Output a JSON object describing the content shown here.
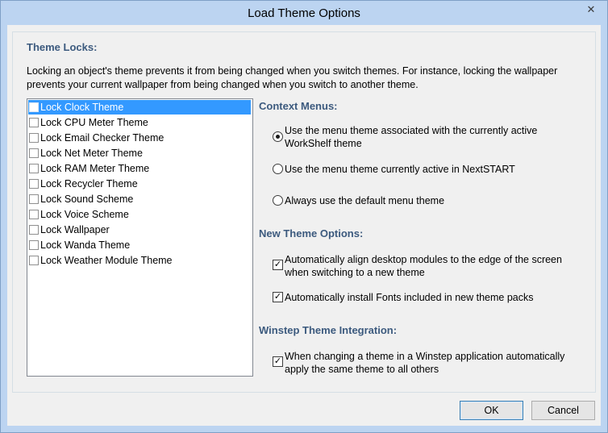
{
  "window": {
    "title": "Load Theme Options"
  },
  "theme_locks": {
    "heading": "Theme Locks:",
    "description": "Locking an object's theme prevents it from being changed when you switch themes. For instance, locking the wallpaper prevents your current wallpaper from being changed when you switch to another theme.",
    "items": [
      {
        "label": "Lock Clock Theme",
        "checked": false,
        "selected": true
      },
      {
        "label": "Lock CPU Meter Theme",
        "checked": false,
        "selected": false
      },
      {
        "label": "Lock Email Checker Theme",
        "checked": false,
        "selected": false
      },
      {
        "label": "Lock Net Meter Theme",
        "checked": false,
        "selected": false
      },
      {
        "label": "Lock RAM Meter Theme",
        "checked": false,
        "selected": false
      },
      {
        "label": "Lock Recycler Theme",
        "checked": false,
        "selected": false
      },
      {
        "label": "Lock Sound Scheme",
        "checked": false,
        "selected": false
      },
      {
        "label": "Lock Voice Scheme",
        "checked": false,
        "selected": false
      },
      {
        "label": "Lock Wallpaper",
        "checked": false,
        "selected": false
      },
      {
        "label": "Lock Wanda Theme",
        "checked": false,
        "selected": false
      },
      {
        "label": "Lock Weather Module Theme",
        "checked": false,
        "selected": false
      }
    ]
  },
  "context_menus": {
    "heading": "Context Menus:",
    "options": [
      {
        "label": "Use the menu theme associated with the currently active WorkShelf theme",
        "selected": true
      },
      {
        "label": "Use the menu theme currently active in NextSTART",
        "selected": false
      },
      {
        "label": "Always use the default menu theme",
        "selected": false
      }
    ]
  },
  "new_theme_options": {
    "heading": "New Theme Options:",
    "options": [
      {
        "label": "Automatically align desktop modules to the edge of the screen when switching to a new theme",
        "checked": true
      },
      {
        "label": "Automatically install Fonts included in new theme packs",
        "checked": true
      }
    ]
  },
  "integration": {
    "heading": "Winstep Theme Integration:",
    "options": [
      {
        "label": "When changing a theme in a Winstep application automatically apply the same theme to all others",
        "checked": true
      }
    ]
  },
  "buttons": {
    "ok": "OK",
    "cancel": "Cancel"
  },
  "icons": {
    "close": "✕",
    "check": "✓"
  },
  "colors": {
    "accent_heading": "#3c5a7e",
    "selection": "#3399ff"
  }
}
